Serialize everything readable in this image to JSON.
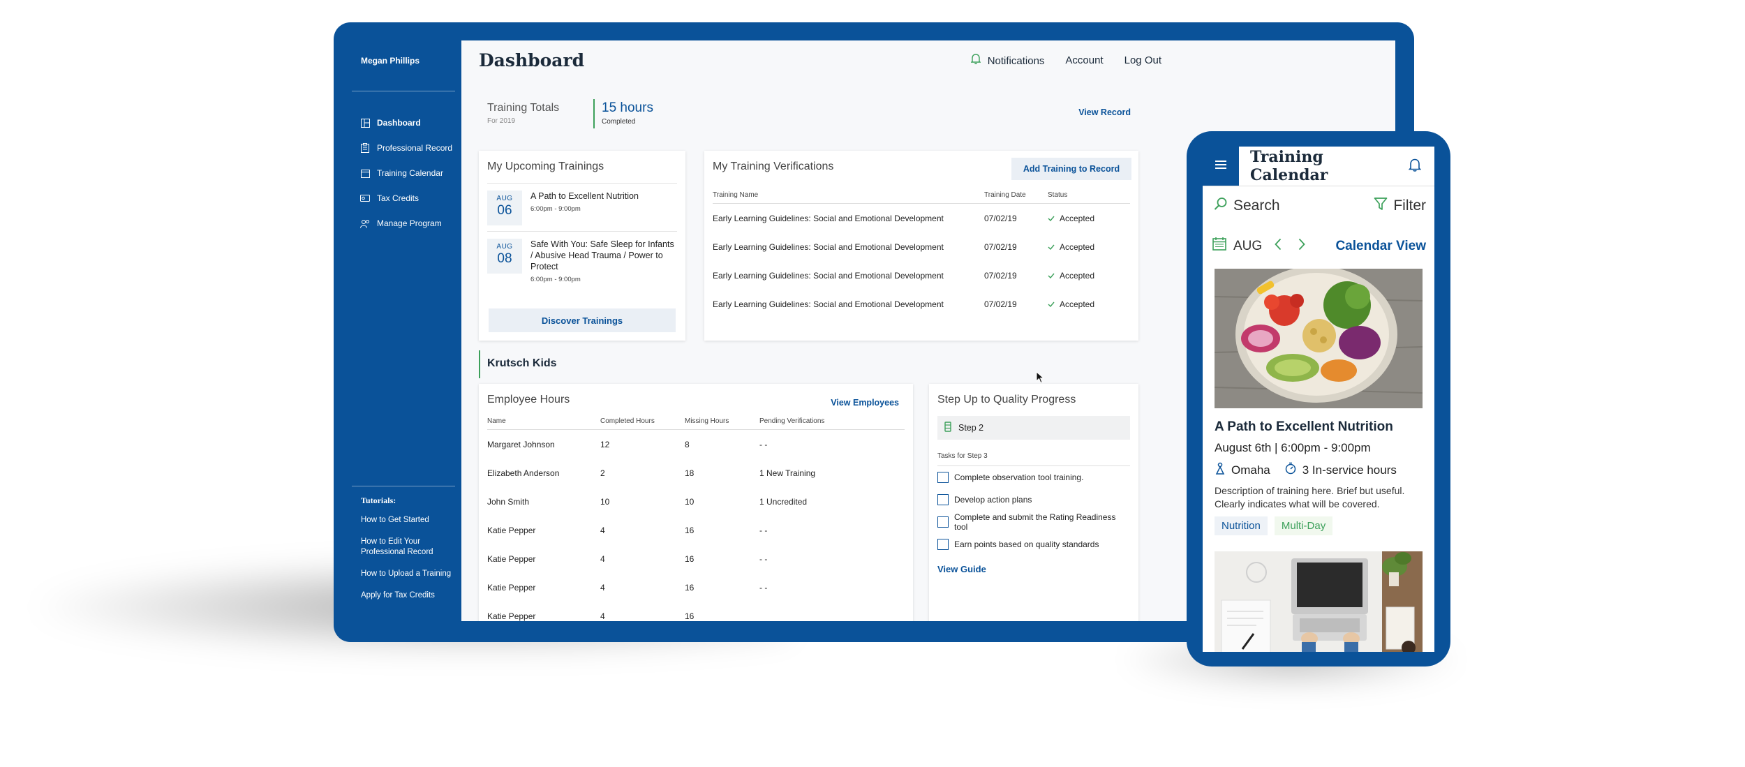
{
  "sidebar": {
    "user_name": "Megan Phillips",
    "nav": [
      {
        "label": "Dashboard",
        "icon": "dashboard-icon",
        "active": true
      },
      {
        "label": "Professional Record",
        "icon": "clipboard-icon",
        "active": false
      },
      {
        "label": "Training Calendar",
        "icon": "calendar-icon",
        "active": false
      },
      {
        "label": "Tax Credits",
        "icon": "ticket-icon",
        "active": false
      },
      {
        "label": "Manage Program",
        "icon": "users-icon",
        "active": false
      }
    ],
    "tutorials_title": "Tutorials:",
    "tutorials": [
      "How to Get Started",
      "How to Edit Your Professional Record",
      "How to Upload a Training",
      "Apply for Tax Credits"
    ]
  },
  "header": {
    "title": "Dashboard",
    "notifications": "Notifications",
    "account": "Account",
    "logout": "Log Out"
  },
  "totals": {
    "label": "Training Totals",
    "sub": "For 2019",
    "hours": "15 hours",
    "completed": "Completed",
    "view_record": "View Record"
  },
  "upcoming": {
    "title": "My Upcoming Trainings",
    "items": [
      {
        "month": "AUG",
        "day": "06",
        "name": "A Path to Excellent Nutrition",
        "time": "6:00pm - 9:00pm"
      },
      {
        "month": "AUG",
        "day": "08",
        "name": "Safe With You: Safe Sleep for Infants / Abusive Head Trauma / Power to Protect",
        "time": "6:00pm - 9:00pm"
      }
    ],
    "button": "Discover Trainings"
  },
  "verifications": {
    "title": "My Training Verifications",
    "add_button": "Add Training to Record",
    "columns": [
      "Training Name",
      "Training Date",
      "Status"
    ],
    "rows": [
      {
        "name": "Early Learning Guidelines: Social and Emotional Development",
        "date": "07/02/19",
        "status": "Accepted"
      },
      {
        "name": "Early Learning Guidelines: Social and Emotional Development",
        "date": "07/02/19",
        "status": "Accepted"
      },
      {
        "name": "Early Learning Guidelines: Social and Emotional Development",
        "date": "07/02/19",
        "status": "Accepted"
      },
      {
        "name": "Early Learning Guidelines: Social and Emotional Development",
        "date": "07/02/19",
        "status": "Accepted"
      }
    ]
  },
  "section_title": "Krutsch Kids",
  "employees": {
    "title": "Employee Hours",
    "view_link": "View Employees",
    "columns": [
      "Name",
      "Completed Hours",
      "Missing Hours",
      "Pending Verifications"
    ],
    "rows": [
      {
        "name": "Margaret Johnson",
        "completed": "12",
        "missing": "8",
        "pending": "- -"
      },
      {
        "name": "Elizabeth Anderson",
        "completed": "2",
        "missing": "18",
        "pending": "1 New Training"
      },
      {
        "name": "John Smith",
        "completed": "10",
        "missing": "10",
        "pending": "1 Uncredited"
      },
      {
        "name": "Katie Pepper",
        "completed": "4",
        "missing": "16",
        "pending": "- -"
      },
      {
        "name": "Katie Pepper",
        "completed": "4",
        "missing": "16",
        "pending": "- -"
      },
      {
        "name": "Katie Pepper",
        "completed": "4",
        "missing": "16",
        "pending": "- -"
      },
      {
        "name": "Katie Pepper",
        "completed": "4",
        "missing": "16",
        "pending": ""
      }
    ]
  },
  "quality": {
    "title": "Step Up to Quality Progress",
    "step": "Step 2",
    "tasks_label": "Tasks for Step 3",
    "tasks": [
      "Complete observation tool training.",
      "Develop action plans",
      "Complete and submit the Rating Readiness tool",
      "Earn points based on quality standards"
    ],
    "guide": "View Guide"
  },
  "phone": {
    "title": "Training Calendar",
    "search_placeholder": "Search",
    "filter": "Filter",
    "month": "AUG",
    "calendar_view": "Calendar View",
    "event": {
      "title": "A Path to Excellent Nutrition",
      "date": "August 6th | 6:00pm - 9:00pm",
      "location": "Omaha",
      "hours": "3 In-service hours",
      "description": "Description of training here. Brief but useful. Clearly indicates what will be covered.",
      "tags": [
        "Nutrition",
        "Multi-Day"
      ]
    }
  },
  "colors": {
    "brand_blue": "#0a5299",
    "accent_green": "#3ca05a",
    "screen_bg": "#f7f8fa"
  }
}
